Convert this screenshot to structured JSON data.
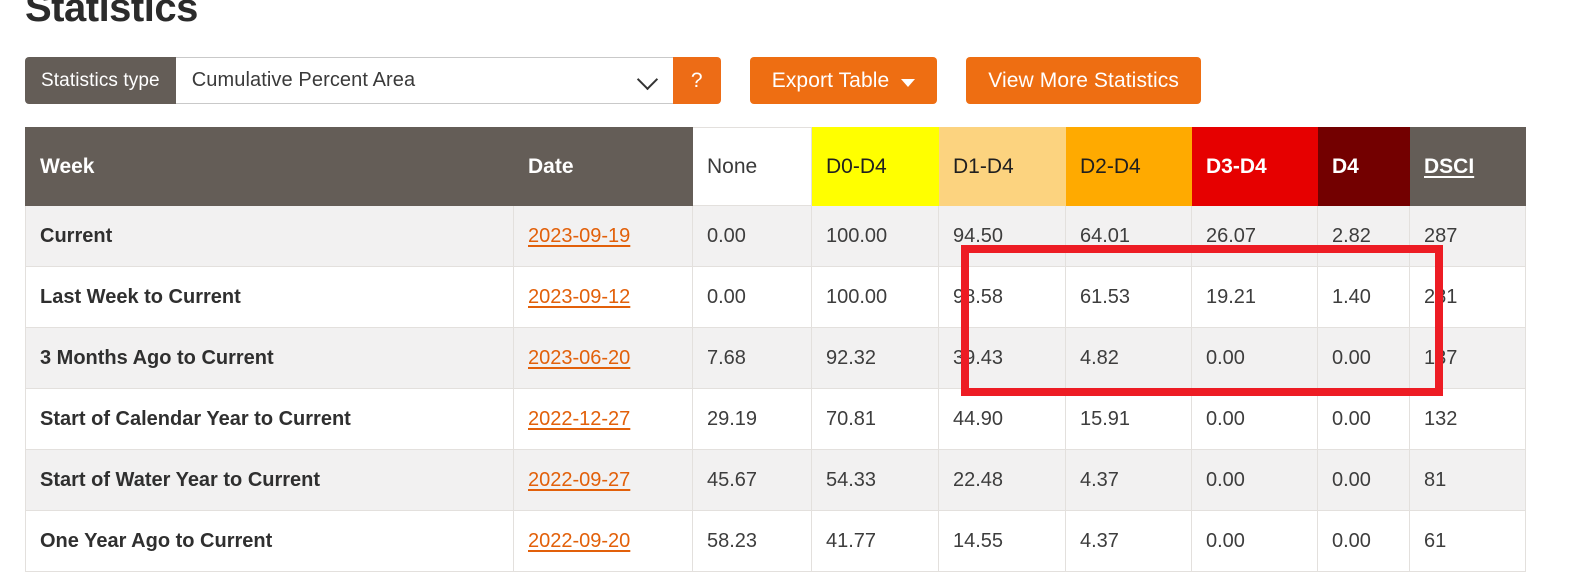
{
  "header": {
    "title": "Statistics"
  },
  "toolbar": {
    "statistics_type_label": "Statistics type",
    "statistics_type_value": "Cumulative Percent Area",
    "statistics_type_placeholder": "Cumulative Percent Area",
    "help_label": "?",
    "export_label": "Export Table",
    "view_more_label": "View More Statistics",
    "accent_color": "#ee6e12",
    "label_bg_color": "#645d57"
  },
  "table": {
    "columns": [
      {
        "key": "week",
        "label": "Week",
        "style": "header-dark"
      },
      {
        "key": "date",
        "label": "Date",
        "style": "header-dark"
      },
      {
        "key": "none",
        "label": "None",
        "style": "none",
        "color": "#ffffff"
      },
      {
        "key": "d0",
        "label": "D0-D4",
        "style": "d0",
        "color": "#ffff00"
      },
      {
        "key": "d1",
        "label": "D1-D4",
        "style": "d1",
        "color": "#fcd37f"
      },
      {
        "key": "d2",
        "label": "D2-D4",
        "style": "d2",
        "color": "#ffaa00"
      },
      {
        "key": "d3",
        "label": "D3-D4",
        "style": "d3",
        "color": "#e60000"
      },
      {
        "key": "d4",
        "label": "D4",
        "style": "d4",
        "color": "#730000"
      },
      {
        "key": "dsci",
        "label": "DSCI",
        "style": "header-dark-link"
      }
    ],
    "rows": [
      {
        "week": "Current",
        "date": "2023-09-19",
        "none": "0.00",
        "d0": "100.00",
        "d1": "94.50",
        "d2": "64.01",
        "d3": "26.07",
        "d4": "2.82",
        "dsci": "287"
      },
      {
        "week": "Last Week to Current",
        "date": "2023-09-12",
        "none": "0.00",
        "d0": "100.00",
        "d1": "98.58",
        "d2": "61.53",
        "d3": "19.21",
        "d4": "1.40",
        "dsci": "281"
      },
      {
        "week": "3 Months Ago to Current",
        "date": "2023-06-20",
        "none": "7.68",
        "d0": "92.32",
        "d1": "39.43",
        "d2": "4.82",
        "d3": "0.00",
        "d4": "0.00",
        "dsci": "137"
      },
      {
        "week": "Start of Calendar Year to Current",
        "date": "2022-12-27",
        "none": "29.19",
        "d0": "70.81",
        "d1": "44.90",
        "d2": "15.91",
        "d3": "0.00",
        "d4": "0.00",
        "dsci": "132"
      },
      {
        "week": "Start of Water Year to Current",
        "date": "2022-09-27",
        "none": "45.67",
        "d0": "54.33",
        "d1": "22.48",
        "d2": "4.37",
        "d3": "0.00",
        "d4": "0.00",
        "dsci": "81"
      },
      {
        "week": "One Year Ago to Current",
        "date": "2022-09-20",
        "none": "58.23",
        "d0": "41.77",
        "d1": "14.55",
        "d2": "4.37",
        "d3": "0.00",
        "d4": "0.00",
        "dsci": "61"
      }
    ]
  },
  "annotation": {
    "highlight_color": "#ed1c24",
    "highlight_columns": [
      "D1-D4",
      "D2-D4",
      "D3-D4",
      "D4"
    ]
  }
}
